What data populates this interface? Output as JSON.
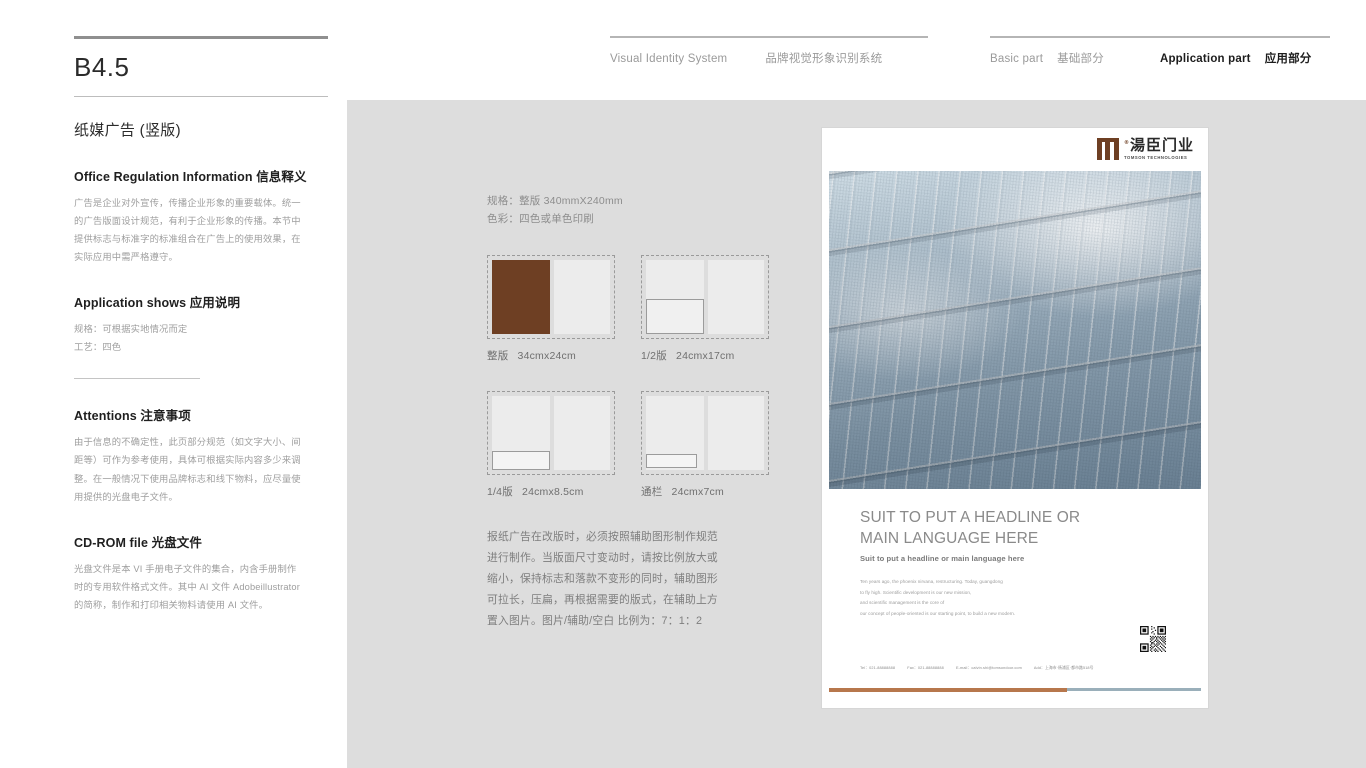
{
  "header": {
    "visual_identity_en": "Visual Identity System",
    "visual_identity_cn": "品牌视觉形象识别系统",
    "basic_part_en": "Basic part",
    "basic_part_cn": "基础部分",
    "application_part_en": "Application part",
    "application_part_cn": "应用部分"
  },
  "left": {
    "doc_code": "B4.5",
    "doc_subtitle": "纸媒广告 (竖版)",
    "sections": [
      {
        "heading_en": "Office Regulation Information",
        "heading_cn": "信息释义",
        "lines": [
          "广告是企业对外宣传，传播企业形象的重要载体。统一",
          "的广告版面设计规范，有利于企业形象的传播。本节中",
          "提供标志与标准字的标准组合在广告上的使用效果，在",
          "实际应用中需严格遵守。"
        ]
      },
      {
        "heading_en": "Application shows",
        "heading_cn": "应用说明",
        "lines": [
          "规格：可根据实地情况而定",
          "工艺：四色"
        ]
      },
      {
        "heading_en": "Attentions",
        "heading_cn": "注意事项",
        "lines": [
          "由于信息的不确定性，此页部分规范（如文字大小、间",
          "距等）可作为参考使用，具体可根据实际内容多少来调",
          "整。在一般情况下使用品牌标志和线下物料，应尽量使",
          "用提供的光盘电子文件。"
        ]
      },
      {
        "heading_en": "CD-ROM file",
        "heading_cn": "光盘文件",
        "lines": [
          "光盘文件是本 VI 手册电子文件的集合，内含手册制作",
          "时的专用软件格式文件。其中 AI 文件 Adobeillustrator",
          "的简称，制作和打印相关物料请使用 AI 文件。"
        ]
      }
    ]
  },
  "center": {
    "spec_size": "规格：整版 340mmX240mm",
    "spec_color": "色彩：四色或单色印刷",
    "layouts": [
      {
        "name": "整版",
        "dim": "34cmx24cm"
      },
      {
        "name": "1/2版",
        "dim": "24cmx17cm"
      },
      {
        "name": "1/4版",
        "dim": "24cmx8.5cm"
      },
      {
        "name": "通栏",
        "dim": "24cmx7cm"
      }
    ],
    "note_lines": [
      "报纸广告在改版时，必须按照辅助图形制作规范",
      "进行制作。当版面尺寸变动时，请按比例放大或",
      "缩小，保持标志和落款不变形的同时，辅助图形",
      "可拉长，压扁，再根据需要的版式，在辅助上方",
      "置入图片。图片/辅助/空白 比例为：7：1：2"
    ]
  },
  "poster": {
    "logo_cn": "湯臣门业",
    "logo_en": "TOMSON TECHNOLOGIES",
    "headline_line1": "SUIT TO PUT A HEADLINE OR",
    "headline_line2": "MAIN LANGUAGE HERE",
    "subheadline": "Suit to put a headline or main language here",
    "body_lines": [
      "Ten years ago, the phoenix nirvana, restructuring. Today, guangdong",
      "to fly high. Scientific development is our new mission,",
      "and scientific management is the core of",
      "our concept of people-oriented is our starting point, to build a new modern."
    ],
    "contact": {
      "tel": "Tel：021-88888888",
      "fax": "Fax：021-88888888",
      "email": "E-mail：calvin.shi@tomsondoor.com",
      "address": "Add：上海市·杨浦区·都市路518号"
    }
  },
  "colors": {
    "brand_brown": "#6e3f23",
    "bar_brown": "#b7774c",
    "bar_blue": "#9aafba",
    "canvas_grey": "#dddddd"
  }
}
